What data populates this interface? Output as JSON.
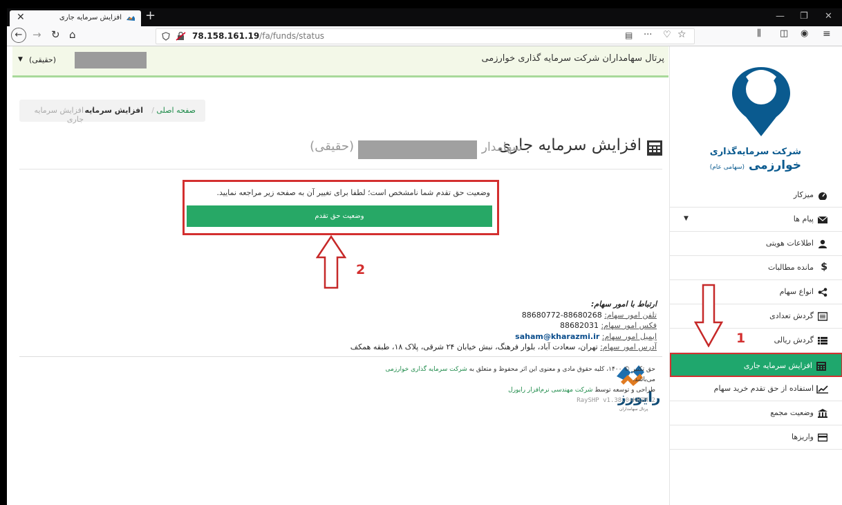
{
  "browser": {
    "tab_title": "افزایش سرمایه جاری",
    "url_host": "78.158.161.19",
    "url_path": "/fa/funds/status",
    "toolbar_dots": "···"
  },
  "header": {
    "portal_title": "پرتال سهامداران شرکت سرمایه گذاری خوارزمی",
    "user_type": "(حقیقی)"
  },
  "sidebar": {
    "company_line1": "شرکت سرمایه‌گذاری",
    "company_line2": "خوارزمی",
    "company_line2_sub": "(سهامی عام)",
    "items": [
      {
        "label": "میزکار"
      },
      {
        "label": "پیام ها"
      },
      {
        "label": "اطلاعات هویتی"
      },
      {
        "label": "مانده مطالبات"
      },
      {
        "label": "انواع سهام"
      },
      {
        "label": "گردش تعدادی"
      },
      {
        "label": "گردش ریالی"
      },
      {
        "label": "افزایش سرمایه جاری"
      },
      {
        "label": "استفاده از حق تقدم خرید سهام"
      },
      {
        "label": "وضعیت مجمع"
      },
      {
        "label": "واریزها"
      }
    ]
  },
  "breadcrumb": {
    "home": "صفحه اصلی",
    "section": "افزایش سرمایه",
    "current": "افزایش سرمایه جاری",
    "sep": "/"
  },
  "page": {
    "title": "افزایش سرمایه جاری",
    "role": "سهامدار",
    "user_type": "(حقیقی)"
  },
  "alert": {
    "message": "وضعیت حق تقدم شما نامشخص است؛ لطفا برای تغییر آن به صفحه زیر مراجعه نمایید.",
    "button": "وضعیت حق تقدم"
  },
  "annotations": {
    "arrow1_number": "1",
    "arrow2_number": "2"
  },
  "contact": {
    "title": "ارتباط با امور سهام:",
    "phone_label": "تلفن امور سهام:",
    "phone": "88680268-88680772",
    "fax_label": "فکس امور سهام:",
    "fax": "88682031",
    "email_label": "ایمیل امور سهام:",
    "email": "saham@kharazmi.ir",
    "address_label": "آدرس امور سهام:",
    "address": "تهران، سعادت آباد، بلوار فرهنگ، نبش خیابان ۲۴ شرقی، پلاک ۱۸، طبقه همکف"
  },
  "footer": {
    "copyright_prefix": "حق تکثیر © ۱۴۰۰، کلیه حقوق مادی و معنوی این اثر محفوظ و متعلق به",
    "company_link": "شرکت سرمایه گذاری خوارزمی",
    "copyright_suffix": "می‌باشد.",
    "dev_prefix": "طراحی و توسعه توسط",
    "dev_link": "شرکت مهندسی نرم‌افزار رایورل",
    "version": "RaySHP v1.38.0+KHZM.2",
    "brand": "رایورز",
    "brand_sub": "پرتال سهامداران"
  },
  "colors": {
    "accent_green": "#27a866",
    "annotation_red": "#d32f2f",
    "brand_blue": "#0a5a8f"
  }
}
